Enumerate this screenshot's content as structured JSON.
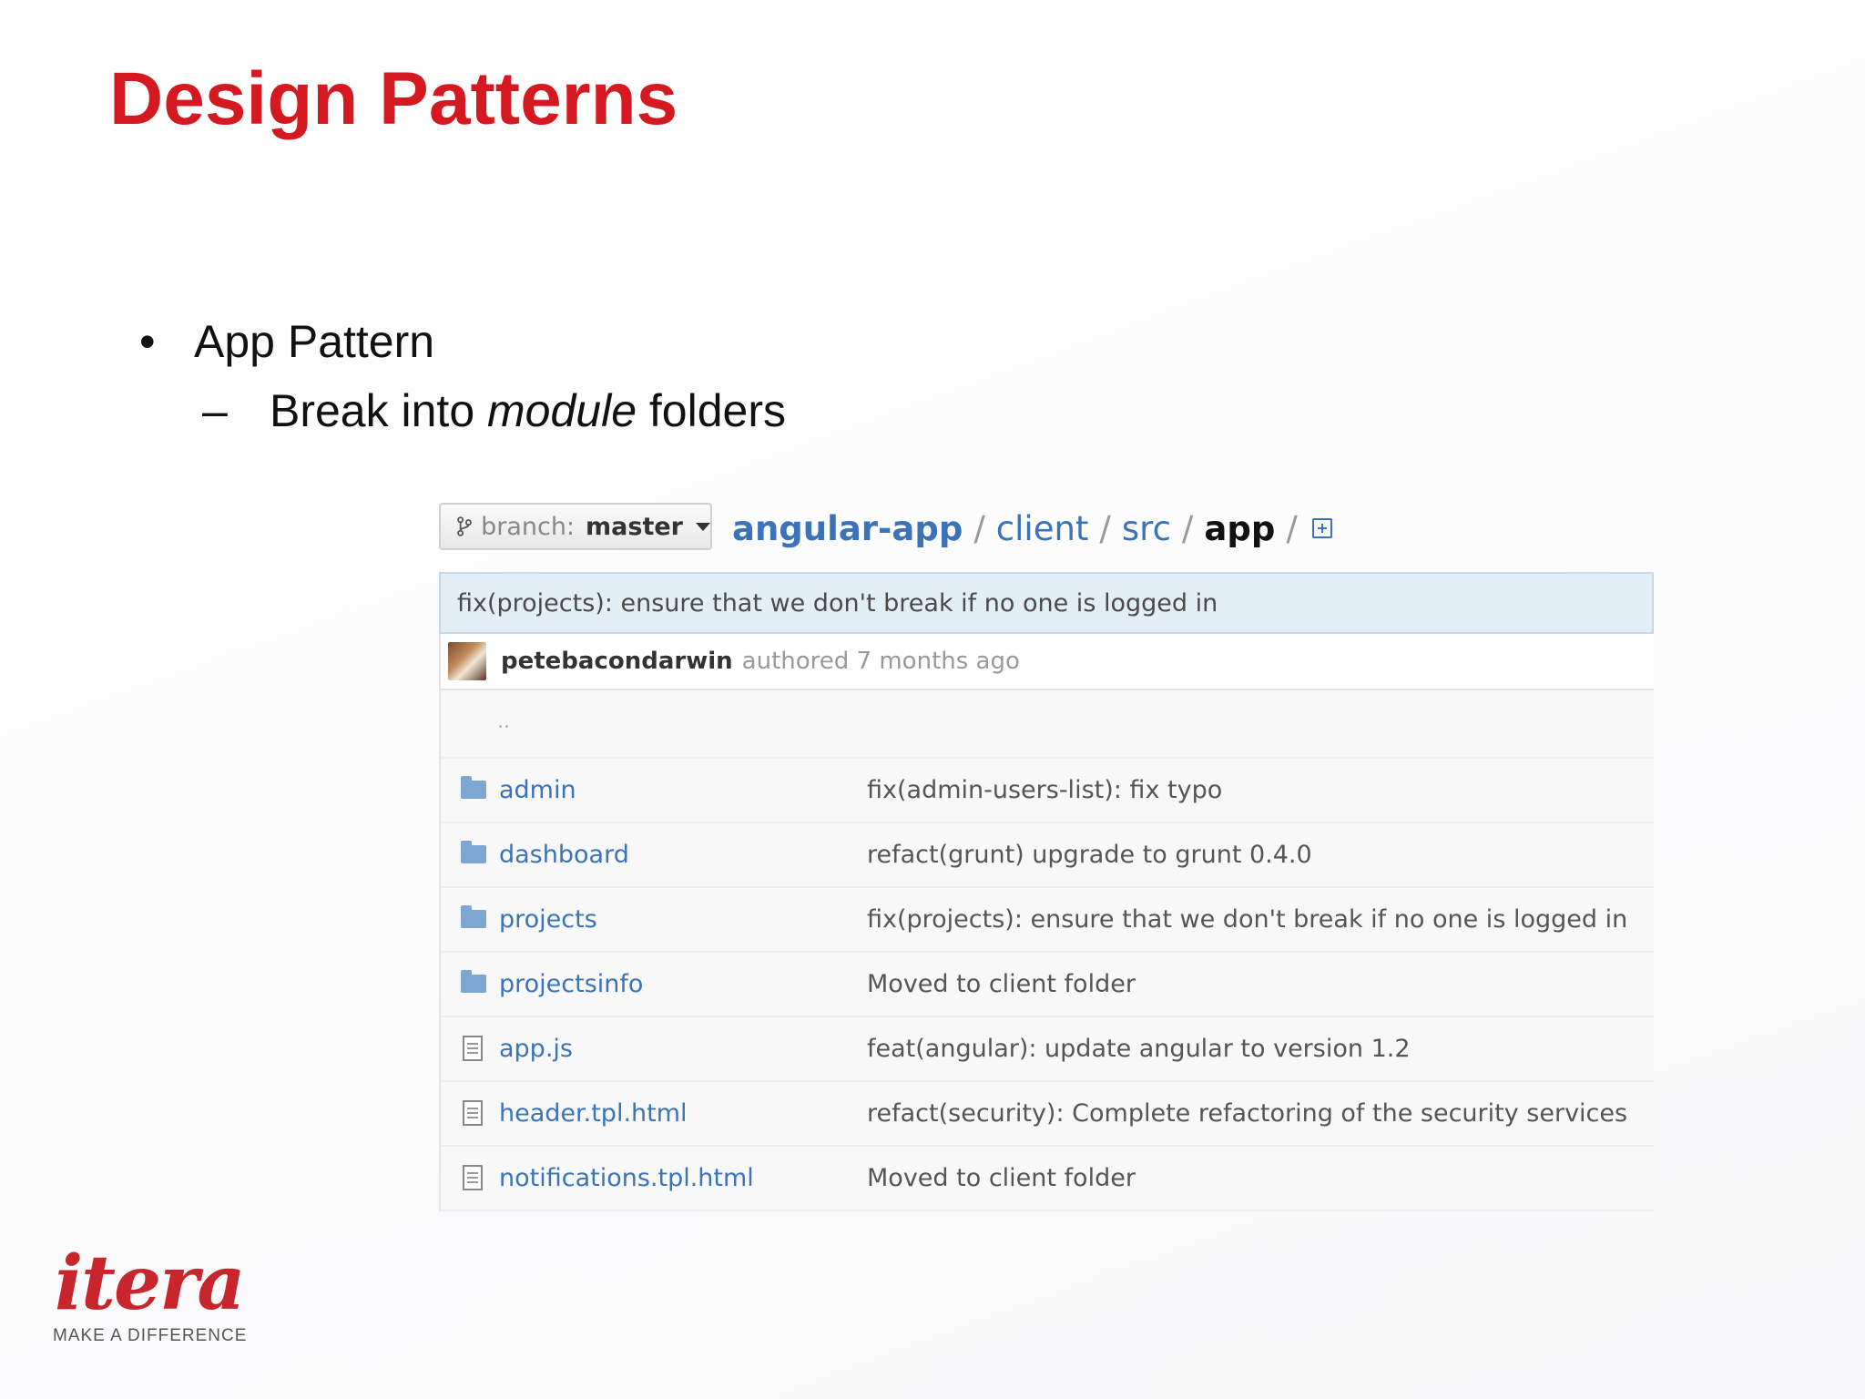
{
  "slide": {
    "title": "Design Patterns",
    "bullet": "App Pattern",
    "sub_bullet": {
      "before": "Break into ",
      "emphasis": "module",
      "after": " folders"
    },
    "title_color": "#d41920"
  },
  "github": {
    "branch": {
      "prefix": "branch:",
      "name": "master",
      "icon": "branch-icon"
    },
    "breadcrumb": {
      "repo": "angular-app",
      "path": [
        "client",
        "src"
      ],
      "current": "app",
      "separator": "/"
    },
    "commit": {
      "message": "fix(projects): ensure that we don't break if no one is logged in",
      "author": "petebacondarwin",
      "meta": "authored 7 months ago"
    },
    "parent_dir": "..",
    "files": [
      {
        "type": "folder",
        "name": "admin",
        "message": "fix(admin-users-list): fix typo"
      },
      {
        "type": "folder",
        "name": "dashboard",
        "message": "refact(grunt) upgrade to grunt 0.4.0"
      },
      {
        "type": "folder",
        "name": "projects",
        "message": "fix(projects): ensure that we don't break if no one is logged in"
      },
      {
        "type": "folder",
        "name": "projectsinfo",
        "message": "Moved to client folder"
      },
      {
        "type": "file",
        "name": "app.js",
        "message": "feat(angular): update angular to version 1.2"
      },
      {
        "type": "file",
        "name": "header.tpl.html",
        "message": "refact(security): Complete refactoring of the security services"
      },
      {
        "type": "file",
        "name": "notifications.tpl.html",
        "message": "Moved to client folder"
      }
    ],
    "link_color": "#3b73b9",
    "commit_bar_color": "#e3eff7"
  },
  "logo": {
    "word": "itera",
    "tagline": "MAKE A DIFFERENCE",
    "color": "#c8262c"
  }
}
